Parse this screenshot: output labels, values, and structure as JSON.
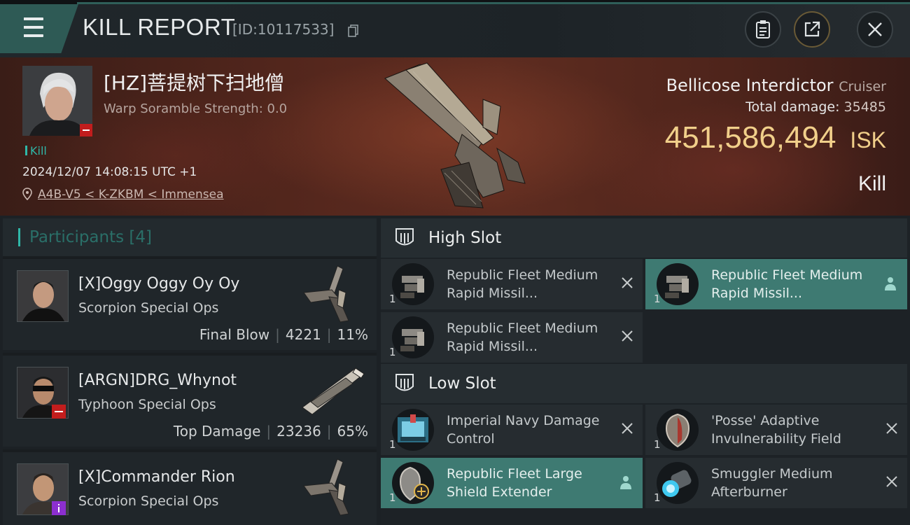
{
  "header": {
    "title": "KILL REPORT",
    "report_id": "[ID:10117533]",
    "menu_icon": "hamburger-icon",
    "buttons": [
      "clipboard-icon",
      "share-icon",
      "close-icon"
    ]
  },
  "victim": {
    "name": "[HZ]菩提树下扫地僧",
    "warp_scramble": "Warp Soramble Strength: 0.0",
    "tag": "Kill",
    "timestamp": "2024/12/07 14:08:15 UTC +1",
    "location": "A4B-V5 < K-ZKBM < Immensea",
    "ship_name": "Bellicose Interdictor",
    "ship_class": "Cruiser",
    "total_damage_label": "Total damage:",
    "total_damage": "35485",
    "isk_value": "451,586,494",
    "isk_unit": "ISK",
    "result": "Kill"
  },
  "participants": {
    "label": "Participants",
    "count": "[4]",
    "rows": [
      {
        "name": "[X]Oggy Oggy Oy Oy",
        "ship": "Scorpion Special Ops",
        "role": "Final Blow",
        "damage": "4221",
        "percent": "11%",
        "badge": "none"
      },
      {
        "name": "[ARGN]DRG_Whynot",
        "ship": "Typhoon Special Ops",
        "role": "Top Damage",
        "damage": "23236",
        "percent": "65%",
        "badge": "red"
      },
      {
        "name": "[X]Commander Rion",
        "ship": "Scorpion Special Ops",
        "role": "",
        "damage": "",
        "percent": "",
        "badge": "purple"
      }
    ]
  },
  "fitting": {
    "high_slot": {
      "label": "High Slot",
      "modules": [
        {
          "name": "Republic Fleet Medium Rapid Missil...",
          "qty": "1",
          "state": "destroyed"
        },
        {
          "name": "Republic Fleet Medium Rapid Missil...",
          "qty": "1",
          "state": "dropped"
        },
        {
          "name": "Republic Fleet Medium Rapid Missil...",
          "qty": "1",
          "state": "destroyed"
        }
      ]
    },
    "low_slot": {
      "label": "Low Slot",
      "modules": [
        {
          "name": "Imperial Navy Damage Control",
          "qty": "1",
          "state": "destroyed"
        },
        {
          "name": "'Posse' Adaptive Invulnerability Field",
          "qty": "1",
          "state": "destroyed"
        },
        {
          "name": "Republic Fleet Large Shield Extender",
          "qty": "1",
          "state": "dropped"
        },
        {
          "name": "Smuggler Medium Afterburner",
          "qty": "1",
          "state": "destroyed"
        }
      ]
    }
  },
  "colors": {
    "accent": "#2fb7a8",
    "highlight": "#3e7a72",
    "isk": "#f1cf8a",
    "loss_badge": "#c21d1d"
  }
}
